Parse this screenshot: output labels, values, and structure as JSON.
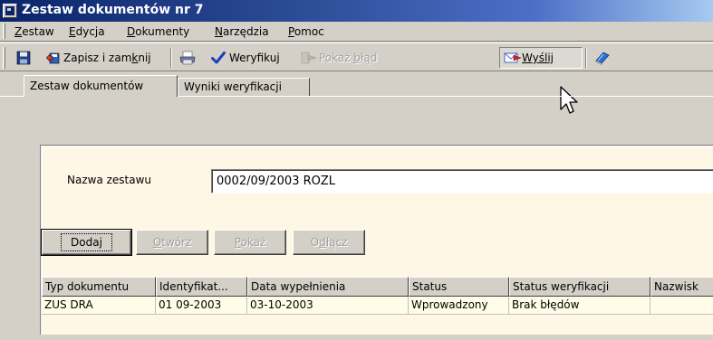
{
  "window": {
    "title": "Zestaw dokumentów nr 7"
  },
  "menu": [
    {
      "pre": "",
      "key": "Z",
      "post": "estaw"
    },
    {
      "pre": "",
      "key": "E",
      "post": "dycja"
    },
    {
      "pre": "",
      "key": "D",
      "post": "okumenty"
    },
    {
      "pre": "",
      "key": "N",
      "post": "arzędzia"
    },
    {
      "pre": "",
      "key": "P",
      "post": "omoc"
    }
  ],
  "toolbar": {
    "save_close": {
      "pre": "Zapisz i zam",
      "key": "k",
      "post": "nij"
    },
    "verify": "Weryfikuj",
    "show_error": {
      "pre": "Pokaż ",
      "key": "b",
      "post": "łąd"
    },
    "send": {
      "pre": "",
      "key": "W",
      "post": "yślij"
    }
  },
  "tabs": [
    "Zestaw dokumentów",
    "Wyniki weryfikacji"
  ],
  "form": {
    "name_label": "Nazwa zestawu",
    "name_value": "0002/09/2003 ROZL"
  },
  "buttons": {
    "add": {
      "pre": "Doda",
      "key": "j",
      "post": ""
    },
    "open": {
      "pre": "",
      "key": "O",
      "post": "twórz"
    },
    "show": {
      "pre": "",
      "key": "P",
      "post": "okaż"
    },
    "detach": {
      "pre": "O",
      "key": "d",
      "post": "łącz"
    }
  },
  "table": {
    "columns": [
      "Typ dokumentu",
      "Identyfikat...",
      "Data wypełnienia",
      "Status",
      "Status weryfikacji",
      "Nazwisk"
    ],
    "rows": [
      [
        "ZUS DRA",
        "01 09-2003",
        "03-10-2003",
        "Wprowadzony",
        "Brak błędów",
        ""
      ]
    ]
  },
  "icons": {
    "app": "app-icon",
    "save": "floppy-disk-icon",
    "save_close": "save-close-icon",
    "print": "printer-icon",
    "verify": "checkmark-icon",
    "show_error": "error-icon",
    "send": "envelope-send-icon",
    "help": "help-book-icon",
    "cursor": "mouse-cursor-icon"
  },
  "colors": {
    "title_bar": "#0a246a",
    "panel": "#fff7e6",
    "grid_row": "#fffde8",
    "face": "#d4d0c8"
  }
}
